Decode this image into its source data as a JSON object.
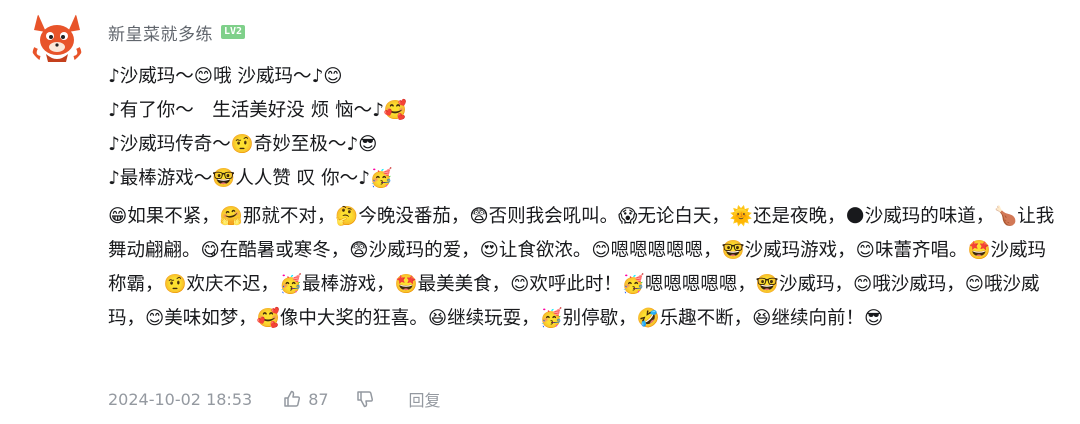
{
  "comment": {
    "username": "新皇菜就多练",
    "level_badge": "LV2",
    "lyrics": [
      "♪沙威玛～😊哦 沙威玛～♪😊",
      "♪有了你～　生活美好没 烦 恼～♪🥰",
      "♪沙威玛传奇～🤨奇妙至极～♪😎",
      "♪最棒游戏～🤓人人赞 叹 你～♪🥳"
    ],
    "paragraph": "😁如果不紧，🤗那就不对，🤔今晚没番茄，😨否则我会吼叫。😱无论白天，🌞还是夜晚，🌑沙威玛的味道，🍗让我舞动翩翩。😋在酷暑或寒冬，😨沙威玛的爱，😍让食欲浓。😊嗯嗯嗯嗯嗯，🤓沙威玛游戏，😊味蕾齐唱。🤩沙威玛称霸，🤨欢庆不迟，🥳最棒游戏，🤩最美美食，😊欢呼此时！🥳嗯嗯嗯嗯嗯，🤓沙威玛，😊哦沙威玛，😊哦沙威玛，😊美味如梦，🥰像中大奖的狂喜。😆继续玩耍，🥳别停歇，🤣乐趣不断，😆继续向前！😎",
    "timestamp": "2024-10-02 18:53",
    "like_count": "87",
    "reply_label": "回复"
  },
  "icons": {
    "like": "thumbs-up-icon",
    "dislike": "thumbs-down-icon",
    "avatar": "fox-avatar"
  },
  "colors": {
    "username": "#61666d",
    "level_badge": "#7fd08a",
    "meta_text": "#9499a0",
    "body_text": "#18191c",
    "avatar_orange": "#e8542a"
  }
}
